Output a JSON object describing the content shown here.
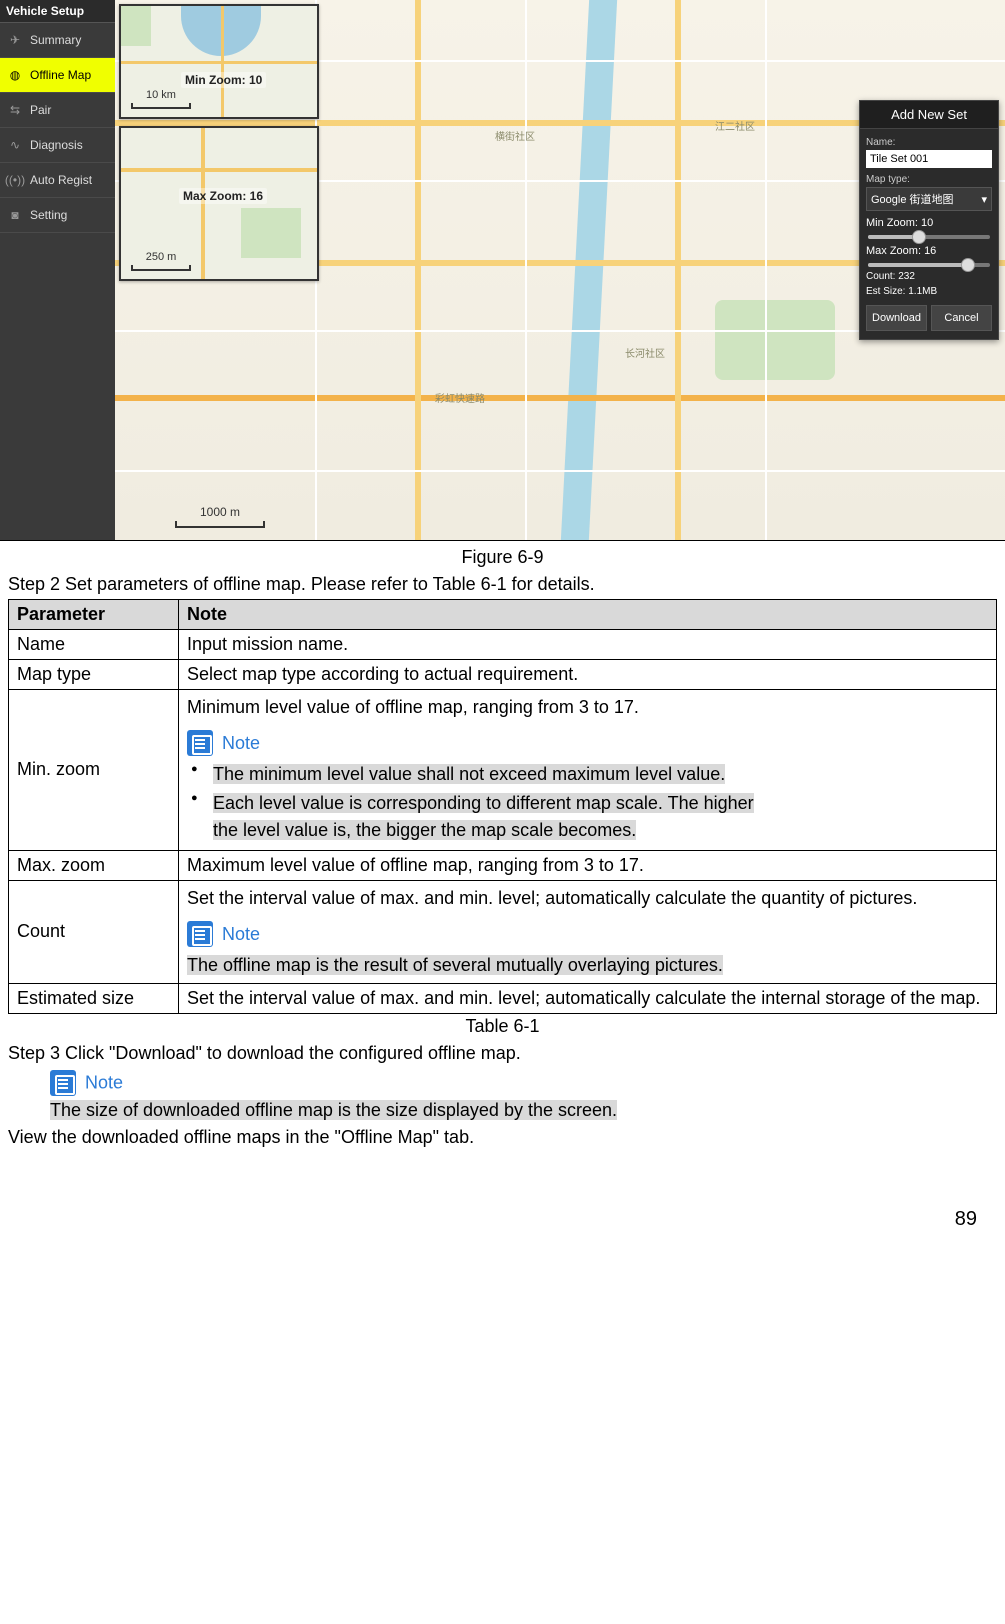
{
  "figure": {
    "caption": "Figure 6-9",
    "sidebar": {
      "header": "Vehicle Setup",
      "items": [
        {
          "icon": "paper-plane-icon",
          "label": "Summary"
        },
        {
          "icon": "globe-icon",
          "label": "Offline Map"
        },
        {
          "icon": "link-icon",
          "label": "Pair"
        },
        {
          "icon": "wave-icon",
          "label": "Diagnosis"
        },
        {
          "icon": "signal-icon",
          "label": "Auto Regist"
        },
        {
          "icon": "camera-icon",
          "label": "Setting"
        }
      ]
    },
    "thumb_min": {
      "title": "Min Zoom: 10",
      "scale": "10 km"
    },
    "thumb_max": {
      "title": "Max Zoom: 16",
      "scale": "250 m"
    },
    "main_scale": "1000 m",
    "panel": {
      "title": "Add New Set",
      "name_label": "Name:",
      "name_value": "Tile Set 001",
      "maptype_label": "Map type:",
      "maptype_value": "Google  街道地图",
      "min_zoom": "Min Zoom: 10",
      "max_zoom": "Max Zoom: 16",
      "count": "Count:   232",
      "est_size": "Est Size:  1.1MB",
      "download": "Download",
      "cancel": "Cancel"
    }
  },
  "step2": "Step 2    Set parameters of offline map. Please refer to Table 6-1 for details.",
  "table": {
    "header": {
      "c1": "Parameter",
      "c2": "Note"
    },
    "rows": {
      "name": {
        "p": "Name",
        "n": "Input mission name."
      },
      "maptype": {
        "p": "Map type",
        "n": "Select map type according to actual requirement."
      },
      "minzoom": {
        "p": "Min. zoom",
        "intro": "Minimum level value of offline map, ranging from 3 to 17.",
        "note_label": "Note",
        "b1": "The minimum level value shall not exceed maximum level value.",
        "b2a": "Each level value is corresponding to different map scale. The higher",
        "b2b": "the level value is, the bigger the map scale becomes."
      },
      "maxzoom": {
        "p": "Max. zoom",
        "n": "Maximum level value of offline map, ranging from 3 to 17."
      },
      "count": {
        "p": "Count",
        "l1": "Set the interval value of max. and min. level; automatically calculate the quantity of pictures.",
        "note_label": "Note",
        "l2": "The offline map is the result of several mutually overlaying pictures."
      },
      "est": {
        "p": "Estimated size",
        "n": "Set the interval value of max. and min. level; automatically calculate the internal storage of the map."
      }
    },
    "caption": "Table 6-1"
  },
  "step3": "Step 3    Click \"Download\" to download the configured offline map.",
  "body_note": {
    "label": "Note",
    "text": "The size of downloaded offline map is the size displayed by the screen."
  },
  "final": "View the downloaded offline maps in the \"Offline Map\" tab.",
  "page_number": "89"
}
